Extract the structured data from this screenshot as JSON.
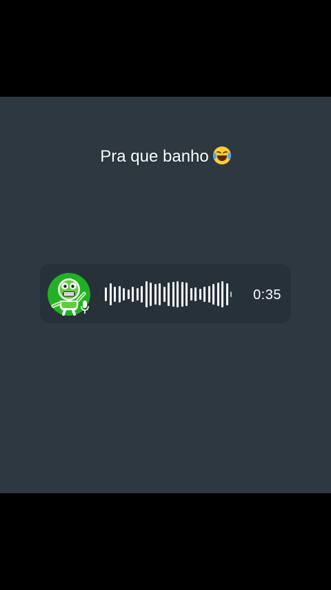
{
  "caption": {
    "text": "Pra que banho",
    "emoji": "face-with-tears-of-joy"
  },
  "voice_message": {
    "avatar_icon": "green-monster-sticker-icon",
    "mic_icon": "microphone-icon",
    "duration": "0:35",
    "waveform_levels": [
      0.5,
      0.8,
      0.55,
      0.6,
      0.45,
      0.35,
      0.55,
      0.45,
      0.6,
      0.95,
      0.85,
      0.75,
      0.8,
      0.55,
      0.85,
      0.9,
      0.95,
      0.9,
      0.85,
      0.45,
      0.5,
      0.4,
      0.55,
      0.6,
      0.75,
      0.85,
      0.95,
      0.8,
      0.2
    ],
    "colors": {
      "avatar_bg": "#22b123",
      "bubble_bg": "#26313a",
      "panel_bg": "#2d3841"
    }
  }
}
